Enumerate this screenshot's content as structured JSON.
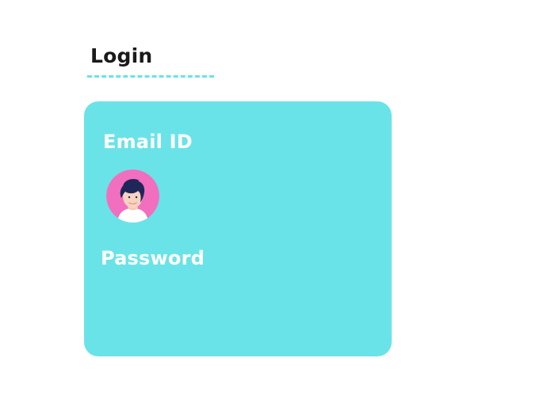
{
  "page": {
    "title": "Login"
  },
  "form": {
    "email_label": "Email ID",
    "password_label": "Password",
    "avatar_icon": "user-avatar-icon"
  },
  "colors": {
    "accent": "#6ae3e8",
    "avatar_bg": "#f26fbf",
    "text_dark": "#1a1a1a",
    "text_light": "#ffffff"
  }
}
